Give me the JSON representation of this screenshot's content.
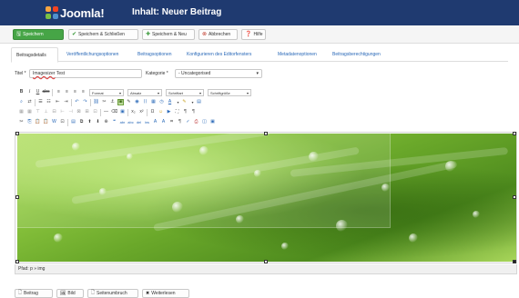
{
  "header": {
    "logo_text": "Joomla!",
    "page_title": "Inhalt: Neuer Beitrag",
    "bg_color": "#1f3a70"
  },
  "toolbar": {
    "save": "Speichern",
    "save_close": "Speichern & Schließen",
    "save_new": "Speichern & Neu",
    "cancel": "Abbrechen",
    "help": "Hilfe"
  },
  "tabs": [
    {
      "label": "Beitragsdetails",
      "active": true
    },
    {
      "label": "Veröffentlichungsoptionen"
    },
    {
      "label": "Beitragsoptionen"
    },
    {
      "label": "Konfigurieren des Editorfensters"
    },
    {
      "label": "Metadatenoptionen"
    },
    {
      "label": "Beitragsberechtigungen"
    }
  ],
  "form": {
    "title_label": "Titel *",
    "title_word1": "Imagesizer",
    "title_word2": "Test",
    "category_label": "Kategorie *",
    "category_value": "- Uncategorised"
  },
  "editor": {
    "format_select": "Format",
    "paragraph_select": "Absatz",
    "font_family_select": "Schriftart",
    "font_size_select": "Schriftgröße",
    "path": "Pfad: p » img"
  },
  "bottom_buttons": {
    "article": "Beitrag",
    "image": "Bild",
    "pagebreak": "Seitenumbruch",
    "readmore": "Weiterlesen"
  }
}
